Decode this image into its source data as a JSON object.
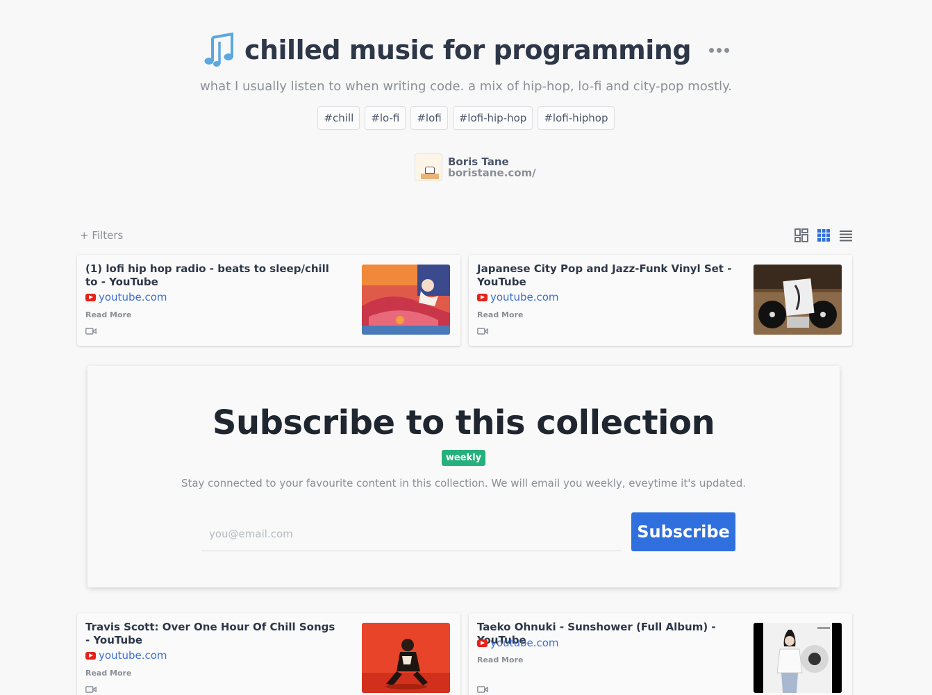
{
  "collection": {
    "title": "chilled music for programming",
    "description": "what I usually listen to when writing code. a mix of hip-hop, lo-fi and city-pop mostly.",
    "tags": [
      "#chill",
      "#lo-fi",
      "#lofi",
      "#lofi-hip-hop",
      "#lofi-hiphop"
    ],
    "icon": "music-notes-icon",
    "accent_color": "#5ba7e0"
  },
  "author": {
    "name": "Boris Tane",
    "website": "boristane.com/"
  },
  "toolbar": {
    "filters_label": "+ Filters",
    "view_modes": [
      "masonry-view",
      "grid-view",
      "list-view"
    ],
    "active_view": "grid-view"
  },
  "cards": [
    {
      "title": "(1) lofi hip hop radio - beats to sleep/chill to - YouTube",
      "source": "youtube.com",
      "read_more": "Read More",
      "type_icon": "video-icon"
    },
    {
      "title": "Japanese City Pop and Jazz-Funk Vinyl Set - YouTube",
      "source": "youtube.com",
      "read_more": "Read More",
      "type_icon": "video-icon"
    },
    {
      "title": "Travis Scott: Over One Hour Of Chill Songs - YouTube",
      "source": "youtube.com",
      "read_more": "Read More",
      "type_icon": "video-icon"
    },
    {
      "title": "Taeko Ohnuki - Sunshower (Full Album) - YouTube",
      "source": "youtube.com",
      "read_more": "Read More",
      "type_icon": "video-icon"
    }
  ],
  "subscribe": {
    "title": "Subscribe to this collection",
    "frequency_badge": "weekly",
    "description": "Stay connected to your favourite content in this collection. We will email you weekly, eveytime it's updated.",
    "email_placeholder": "you@email.com",
    "button_label": "Subscribe",
    "button_color": "#2f6fde",
    "badge_color": "#27b07b"
  }
}
